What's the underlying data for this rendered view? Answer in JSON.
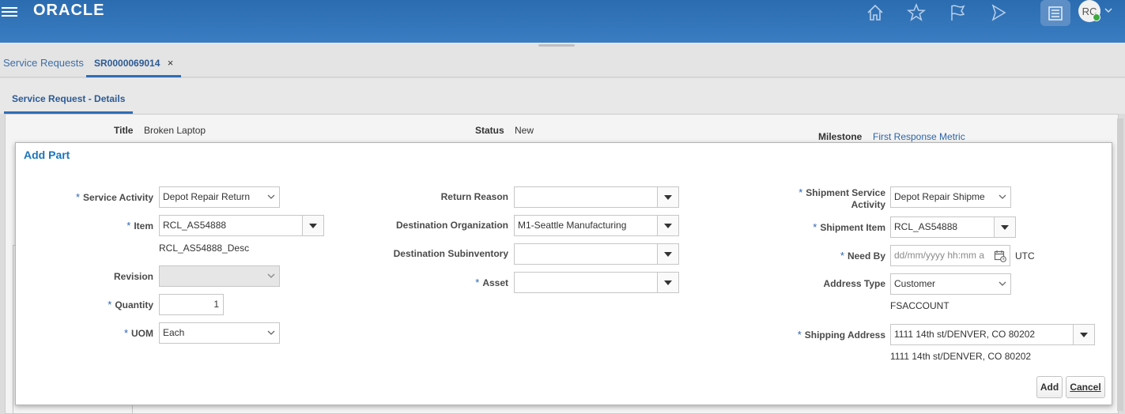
{
  "header": {
    "logo_text": "ORACLE",
    "avatar_initials": "RC",
    "icons": [
      "home-icon",
      "star-icon",
      "flag-icon",
      "navigator-icon",
      "tasks-icon"
    ]
  },
  "tabs": {
    "items": [
      {
        "label": "Service Requests"
      },
      {
        "label": "SR0000069014"
      }
    ],
    "close_symbol": "×"
  },
  "page": {
    "subtab_label": "Service Request - Details",
    "title_label": "Title",
    "title_value": "Broken Laptop",
    "status_label": "Status",
    "status_value": "New",
    "milestone_label": "Milestone",
    "milestone_value": "First Response Metric"
  },
  "dialog": {
    "title": "Add Part",
    "required_mark": "*",
    "service_activity": {
      "label": "Service Activity",
      "value": "Depot Repair Return"
    },
    "item": {
      "label": "Item",
      "value": "RCL_AS54888",
      "description": "RCL_AS54888_Desc"
    },
    "revision": {
      "label": "Revision",
      "value": ""
    },
    "quantity": {
      "label": "Quantity",
      "value": "1"
    },
    "uom": {
      "label": "UOM",
      "value": "Each"
    },
    "return_reason": {
      "label": "Return Reason",
      "value": ""
    },
    "destination_organization": {
      "label": "Destination Organization",
      "value": "M1-Seattle Manufacturing"
    },
    "destination_subinventory": {
      "label": "Destination Subinventory",
      "value": ""
    },
    "asset": {
      "label": "Asset",
      "value": ""
    },
    "shipment_service_activity": {
      "label_line1": "Shipment Service",
      "label_line2": "Activity",
      "value": "Depot Repair Shipme"
    },
    "shipment_item": {
      "label": "Shipment Item",
      "value": "RCL_AS54888"
    },
    "need_by": {
      "label": "Need By",
      "placeholder": "dd/mm/yyyy hh:mm a",
      "timezone": "UTC"
    },
    "address_type": {
      "label": "Address Type",
      "value": "Customer",
      "account": "FSACCOUNT"
    },
    "shipping_address": {
      "label": "Shipping Address",
      "value": "1111 14th st/DENVER, CO 80202",
      "display": "1111 14th st/DENVER, CO 80202"
    },
    "buttons": {
      "add": "Add",
      "cancel": "Cancel"
    }
  },
  "colors": {
    "brand_blue": "#2b6cb0",
    "link_blue": "#1a75bb",
    "required_blue": "#2c64b4"
  }
}
